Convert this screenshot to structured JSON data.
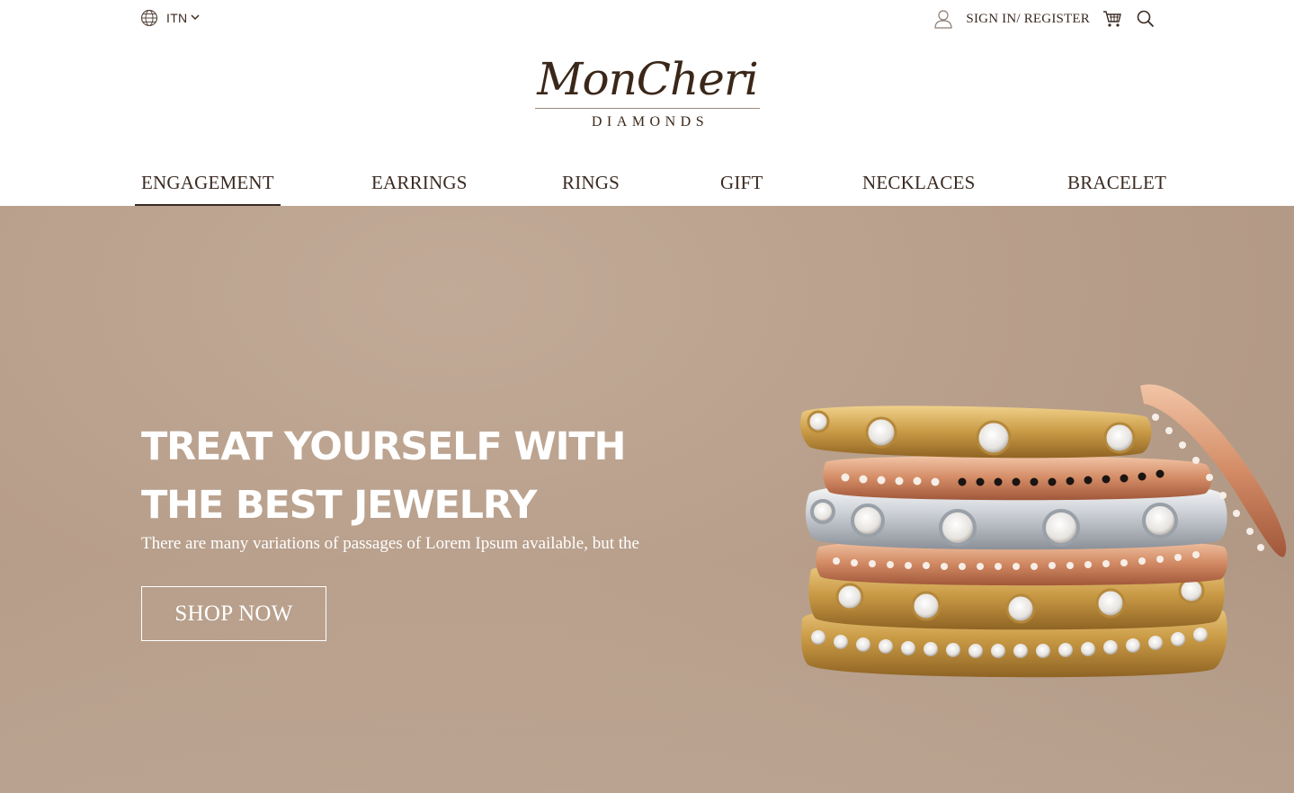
{
  "topbar": {
    "language": {
      "label": "ITN",
      "icon": "globe-icon",
      "chevron": "chevron-down-icon"
    },
    "account": {
      "icon": "user-icon",
      "label": "SIGN IN/ REGISTER"
    },
    "cart": {
      "icon": "cart-icon"
    },
    "search": {
      "icon": "search-icon"
    }
  },
  "logo": {
    "script": "MonCheri",
    "sub": "DIAMONDS"
  },
  "nav": {
    "items": [
      {
        "label": "ENGAGEMENT",
        "active": true
      },
      {
        "label": "EARRINGS",
        "active": false
      },
      {
        "label": "RINGS",
        "active": false
      },
      {
        "label": "GIFT",
        "active": false
      },
      {
        "label": "NECKLACES",
        "active": false
      },
      {
        "label": "BRACELET",
        "active": false
      }
    ]
  },
  "hero": {
    "title": "TREAT YOURSELF WITH THE BEST JEWELRY",
    "subtitle": "There are many variations of passages of Lorem Ipsum available, but the",
    "cta": "SHOP NOW",
    "background": "#b89f8b"
  },
  "colors": {
    "text": "#3a2a22",
    "logo": "#3b2719",
    "hero_text": "#ffffff"
  }
}
